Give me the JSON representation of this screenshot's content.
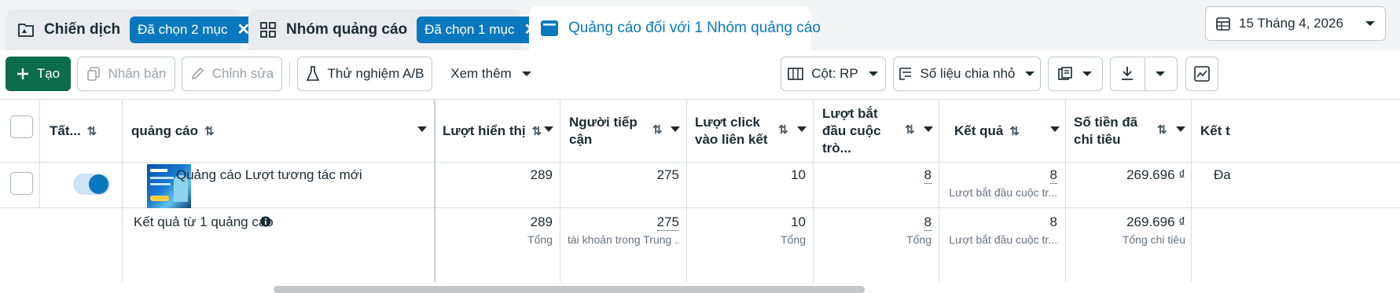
{
  "tabs": {
    "campaigns": {
      "title": "Chiến dịch",
      "pill": "Đã chọn 2 mục"
    },
    "adsets": {
      "title": "Nhóm quảng cáo",
      "pill": "Đã chọn 1 mục"
    },
    "ads": {
      "title": "Quảng cáo đối với 1 Nhóm quảng cáo"
    }
  },
  "date_range": "15 Tháng 4, 2026",
  "toolbar": {
    "create": "Tạo",
    "duplicate": "Nhân bản",
    "edit": "Chỉnh sửa",
    "ab_test": "Thử nghiệm A/B",
    "more": "Xem thêm",
    "columns": "Cột: RP",
    "breakdown": "Số liệu chia nhỏ"
  },
  "table": {
    "headers": {
      "toggle_all": "Tất...",
      "ad": "quảng cáo",
      "impressions": "Lượt hiển thị",
      "reach": "Người tiếp cận",
      "link_clicks": "Lượt click vào liên kết",
      "conversations": "Lượt bắt đầu cuộc trò...",
      "results": "Kết quả",
      "spend": "Số tiền đã chi tiêu",
      "next": "Kết t"
    },
    "row": {
      "name": "Quảng cáo Lượt tương tác mới",
      "impressions": "289",
      "reach": "275",
      "link_clicks": "10",
      "conversations": "8",
      "results": "8",
      "results_sub": "Lượt bắt đầu cuộc tr...",
      "spend": "269.696 ₫",
      "next": "Đa"
    },
    "summary": {
      "label": "Kết quả từ 1 quảng cáo",
      "impressions": "289",
      "impressions_sub": "Tổng",
      "reach": "275",
      "reach_sub": "tài khoản trong Trung ...",
      "link_clicks": "10",
      "link_clicks_sub": "Tổng",
      "conversations": "8",
      "conversations_sub": "Tổng",
      "results": "8",
      "results_sub": "Lượt bắt đầu cuộc tr...",
      "spend": "269.696 ₫",
      "spend_sub": "Tổng chi tiêu"
    }
  },
  "colors": {
    "accent": "#0a78be",
    "create_button": "#0d6c4b",
    "background": "#f2f3f5"
  }
}
